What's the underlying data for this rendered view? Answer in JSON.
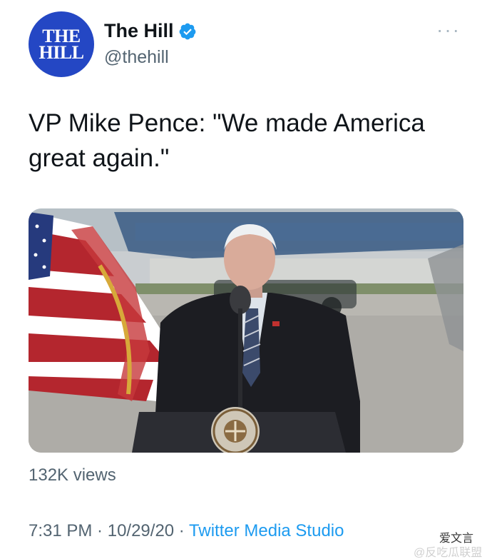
{
  "account": {
    "avatar_line1": "THE",
    "avatar_line2": "HILL",
    "display_name": "The Hill",
    "handle": "@thehill",
    "verified": true
  },
  "more_menu_label": "···",
  "tweet": {
    "text": "VP Mike Pence: \"We made America great again.\""
  },
  "media": {
    "type": "video"
  },
  "stats": {
    "views": "132K views"
  },
  "footer": {
    "time": "7:31 PM",
    "separator1": " · ",
    "date": "10/29/20",
    "separator2": " · ",
    "source": "Twitter Media Studio"
  },
  "watermark": {
    "line1": "爱文言",
    "line2": "@反吃瓜联盟"
  },
  "colors": {
    "brand_blue": "#2447c4",
    "link_blue": "#1d9bf0",
    "secondary_text": "#536471"
  }
}
